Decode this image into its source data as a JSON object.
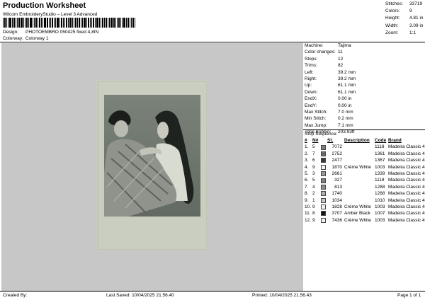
{
  "header": {
    "title": "Production Worksheet",
    "subtitle": "Wilcom EmbroideryStudio – Level 3 Advanced",
    "design_label": "Design:",
    "design_value": "PHOTOEMBRO 050425 fixed 4,8IN",
    "colorway_label": "Colorway:",
    "colorway_value": "Colorway 1"
  },
  "summary": [
    {
      "label": "Stitches:",
      "value": "33719"
    },
    {
      "label": "Colors:",
      "value": "9"
    },
    {
      "label": "Height:",
      "value": "4.81 in"
    },
    {
      "label": "Width:",
      "value": "3.09 in"
    },
    {
      "label": "Zoom:",
      "value": "1:1"
    }
  ],
  "stats": [
    {
      "label": "Machine:",
      "value": "Tajima"
    },
    {
      "label": "Color changes:",
      "value": "11"
    },
    {
      "label": "Stops:",
      "value": "12"
    },
    {
      "label": "Trims:",
      "value": "82"
    },
    {
      "label": "Left:",
      "value": "39.2 mm"
    },
    {
      "label": "Right:",
      "value": "39.2 mm"
    },
    {
      "label": "Up:",
      "value": "61.1 mm"
    },
    {
      "label": "Down:",
      "value": "61.1 mm"
    },
    {
      "label": "EndX:",
      "value": "0.00 in"
    },
    {
      "label": "EndY:",
      "value": "0.00 in"
    },
    {
      "label": "Max Stitch:",
      "value": "7.0 mm"
    },
    {
      "label": "Min Stitch:",
      "value": "0.2 mm"
    },
    {
      "label": "Max Jump:",
      "value": "7.1 mm"
    },
    {
      "label": "Total Bobbin:",
      "value": "203.93ft"
    }
  ],
  "stop_sequence": {
    "title": "Stop Sequence:",
    "headers": [
      "#",
      "N#",
      "St.",
      "Description",
      "Code",
      "Brand"
    ],
    "rows": [
      {
        "idx": "1.",
        "n": "5",
        "color": "#7e7e7e",
        "st": "7072",
        "desc": "",
        "code": "1118",
        "brand": "Madeira Classic 40"
      },
      {
        "idx": "2.",
        "n": "7",
        "color": "#6a6a6a",
        "st": "2752",
        "desc": "",
        "code": "1361",
        "brand": "Madeira Classic 40"
      },
      {
        "idx": "3.",
        "n": "6",
        "color": "#3a3a3a",
        "st": "2477",
        "desc": "",
        "code": "1367",
        "brand": "Madeira Classic 40"
      },
      {
        "idx": "4.",
        "n": "9",
        "color": "#f4f2e8",
        "st": "1870",
        "desc": "Crème White",
        "code": "1003",
        "brand": "Madeira Classic 40"
      },
      {
        "idx": "5.",
        "n": "3",
        "color": "#9a9a9a",
        "st": "2661",
        "desc": "",
        "code": "1339",
        "brand": "Madeira Classic 40"
      },
      {
        "idx": "6.",
        "n": "5",
        "color": "#7e7e7e",
        "st": "327",
        "desc": "",
        "code": "1118",
        "brand": "Madeira Classic 40"
      },
      {
        "idx": "7.",
        "n": "4",
        "color": "#8c8c8c",
        "st": "813",
        "desc": "",
        "code": "1288",
        "brand": "Madeira Classic 40"
      },
      {
        "idx": "8.",
        "n": "2",
        "color": "#b0b0b0",
        "st": "1740",
        "desc": "",
        "code": "1288",
        "brand": "Madeira Classic 40"
      },
      {
        "idx": "9.",
        "n": "1",
        "color": "#c8c8c8",
        "st": "1034",
        "desc": "",
        "code": "1010",
        "brand": "Madeira Classic 40"
      },
      {
        "idx": "10.",
        "n": "9",
        "color": "#f4f2e8",
        "st": "1828",
        "desc": "Crème White",
        "code": "1003",
        "brand": "Madeira Classic 40"
      },
      {
        "idx": "11.",
        "n": "8",
        "color": "#151515",
        "st": "3707",
        "desc": "Amber Black",
        "code": "1007",
        "brand": "Madeira Classic 40"
      },
      {
        "idx": "12.",
        "n": "9",
        "color": "#f4f2e8",
        "st": "7436",
        "desc": "Crème White",
        "code": "1003",
        "brand": "Madeira Classic 40"
      }
    ]
  },
  "footer": {
    "created_by": "Created By:",
    "last_saved": "Last Saved: 10/04/2025 21.56.40",
    "printed": "Printed: 10/04/2025 21.56.43",
    "page": "Page 1 of 1"
  }
}
